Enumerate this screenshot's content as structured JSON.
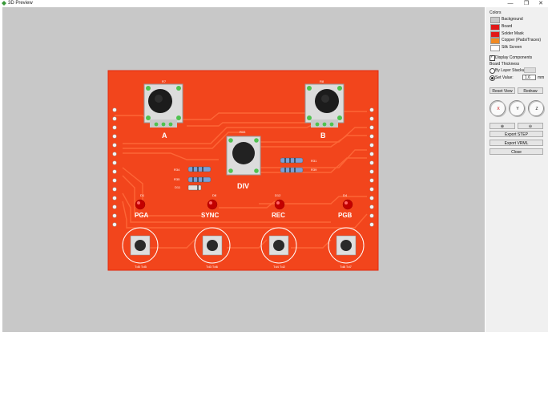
{
  "window": {
    "title": "3D Preview",
    "min_glyph": "—",
    "max_glyph": "❐",
    "close_glyph": "✕"
  },
  "colors_section": {
    "heading": "Colors",
    "items": [
      {
        "label": "Background",
        "color": "#c8c8c8"
      },
      {
        "label": "Board",
        "color": "#e21818"
      },
      {
        "label": "Solder Mask",
        "color": "#e21818"
      },
      {
        "label": "Copper (Pads/Traces)",
        "color": "#f08a24"
      },
      {
        "label": "Silk Screen",
        "color": "#ffffff"
      }
    ]
  },
  "options": {
    "display_components_label": "Display Components",
    "display_components_checked": true,
    "board_thickness_label": "Board Thickness",
    "by_layer_stackup_label": "By Layer Stackup",
    "set_value_label": "Set Value:",
    "set_value": "1.6",
    "unit": "mm"
  },
  "buttons": {
    "reset_view": "Reset View",
    "redraw": "Redraw",
    "export_step": "Export STEP",
    "export_vrml": "Export VRML",
    "close": "Close"
  },
  "axes": {
    "x": "X",
    "y": "Y",
    "z": "Z"
  },
  "board": {
    "accent_color": "#f2451c",
    "knob_labels": {
      "a": "A",
      "b": "B",
      "div": "DIV"
    },
    "ref_r7": "R7",
    "ref_r8": "R8",
    "ref_r33": "R33",
    "ref_r34": "R34",
    "ref_r35": "R35",
    "ref_d11": "D11",
    "ref_r31": "R31",
    "ref_r39": "R39",
    "led_refs": [
      "D1",
      "D8",
      "D12",
      "D4"
    ],
    "button_labels": [
      "PGA",
      "SYNC",
      "REC",
      "PGB"
    ],
    "button_foot": [
      "Td5 Td5",
      "Td3 Td6",
      "Td4 Td2",
      "Td8 Td7"
    ]
  }
}
